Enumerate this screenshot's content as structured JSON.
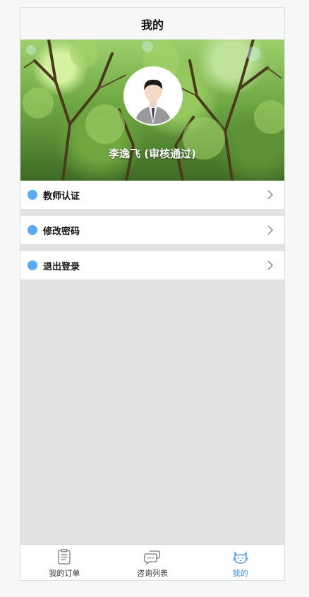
{
  "header": {
    "title": "我的"
  },
  "profile": {
    "name": "李逸飞 (审核通过)"
  },
  "menu": [
    {
      "label": "教师认证",
      "icon": "dot-icon"
    },
    {
      "label": "修改密码",
      "icon": "dot-icon"
    },
    {
      "label": "退出登录",
      "icon": "dot-icon"
    }
  ],
  "tabbar": {
    "items": [
      {
        "label": "我的订单",
        "icon": "clipboard-icon",
        "active": false
      },
      {
        "label": "咨询列表",
        "icon": "chat-icon",
        "active": false
      },
      {
        "label": "我的",
        "icon": "cat-icon",
        "active": true
      }
    ]
  },
  "colors": {
    "accent": "#3b8fe6",
    "menu_dot": "#5aa9f5",
    "background": "#e2e2e2"
  }
}
